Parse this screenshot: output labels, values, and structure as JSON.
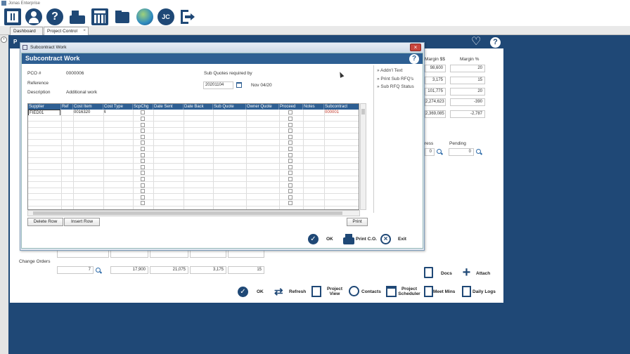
{
  "app_title": "Jonas Enterprise",
  "tabs": [
    "Dashboard",
    "Project Control"
  ],
  "tab_close": "×",
  "toolbar_icons": [
    "qr-code-icon",
    "user-icon",
    "help-icon",
    "fax-print-icon",
    "calculator-icon",
    "folder-icon",
    "globe-icon",
    "jc-logo-icon",
    "logout-icon"
  ],
  "project_control": {
    "header_letter": "P",
    "columns": {
      "margin_dollars": "Margin $$",
      "margin_pct": "Margin %"
    },
    "rows": [
      [
        "98,600",
        "20"
      ],
      [
        "3,175",
        "15"
      ],
      [
        "101,775",
        "20"
      ],
      [
        "2,274,623",
        "-390"
      ],
      [
        "2,369,085",
        "-2,787"
      ]
    ],
    "progress_label": "ress",
    "pending_label": "Pending",
    "progress_value": "0",
    "pending_value": "0",
    "change_orders_label": "Change Orders",
    "change_orders": [
      "7",
      "17,900",
      "21,075",
      "3,175",
      "15"
    ],
    "docs_label": "Docs",
    "attach_label": "Attach",
    "bottom_buttons": {
      "ok": "OK",
      "refresh": "Refresh",
      "project_view": "Project View",
      "contacts": "Contacts",
      "project_scheduler": "Project Scheduler",
      "meet_mins": "Meet Mins",
      "daily_logs": "Daily Logs"
    }
  },
  "dialog": {
    "title": "Subcontract Work",
    "header": "Subcontract Work",
    "pco_label": "PCO #",
    "pco_value": "0000006",
    "reference_label": "Reference",
    "reference_value": "",
    "description_label": "Description",
    "description_value": "Additional work",
    "sub_quotes_label": "Sub Quotes required by",
    "sub_quotes_date": "20201104",
    "sub_quotes_date_text": "Nov 04/20",
    "side_links": [
      "» Addn'l Text",
      "» Print Sub RFQ's",
      "» Sub RFQ Status"
    ],
    "grid_headers": [
      "Supplier",
      "Ref",
      "Cost Item",
      "Cost Type",
      "ScpChg",
      "Date Sent",
      "Date Back",
      "Sub Quote",
      "Owner Quote",
      "Proceed",
      "Notes",
      "Subcontract",
      "C"
    ],
    "grid_rows": [
      {
        "supplier": "FIED01",
        "ref": "",
        "cost_item": "0016320",
        "cost_type": "4",
        "subcontract": "000001"
      }
    ],
    "buttons": {
      "delete_row": "Delete Row",
      "insert_row": "Insert Row",
      "print": "Print",
      "ok": "OK",
      "print_co": "Print C.O.",
      "exit": "Exit"
    }
  }
}
